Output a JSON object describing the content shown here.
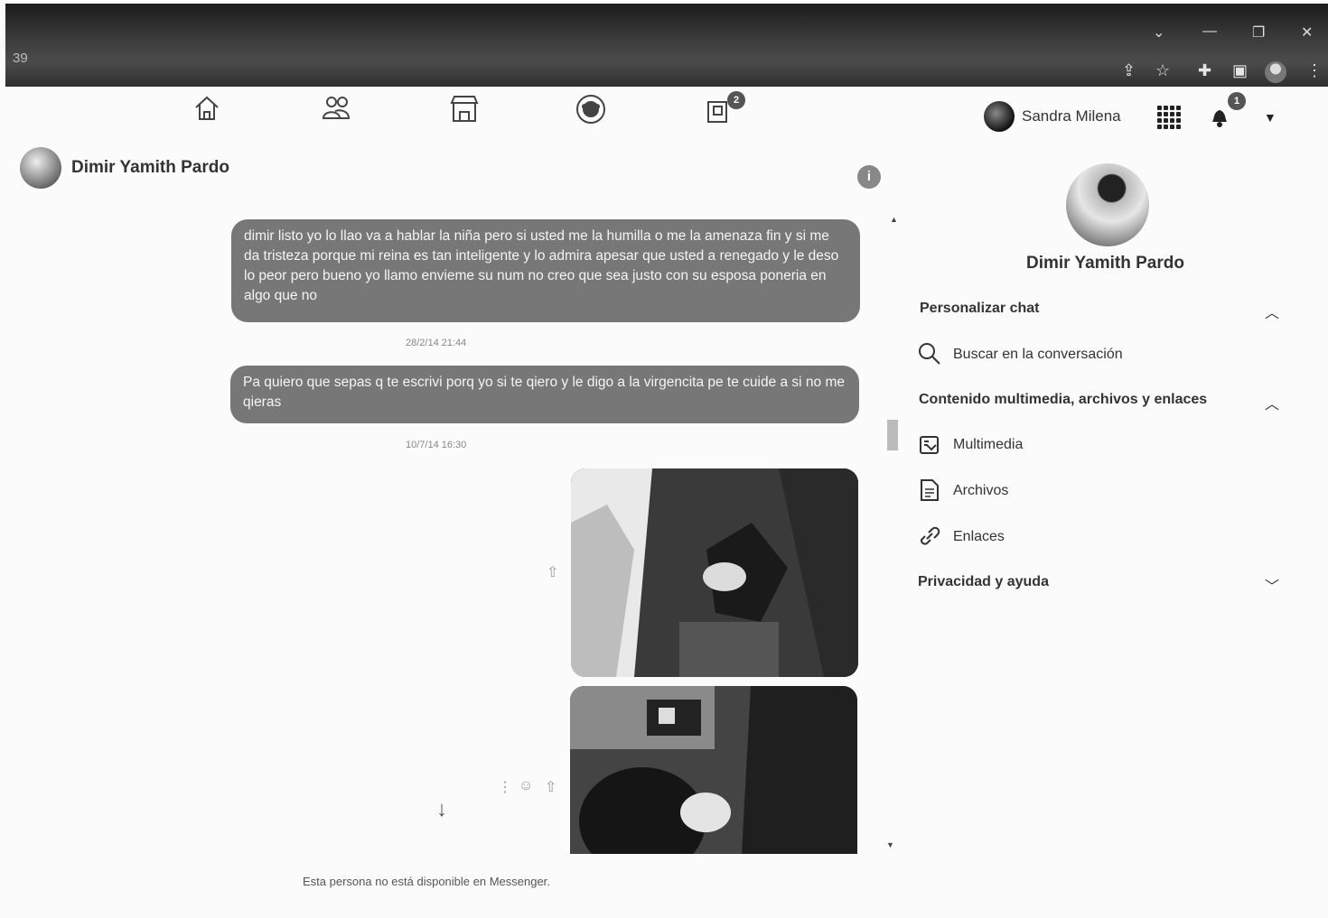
{
  "browser": {
    "tab_number": "39",
    "window_controls": [
      "⌄",
      "—",
      "❐",
      "✕"
    ],
    "toolbar_icons": [
      "share-icon",
      "star-icon",
      "extension-icon",
      "sidepanel-icon",
      "profile-icon",
      "menu-icon"
    ]
  },
  "topnav": {
    "icons": [
      "home-icon",
      "friends-icon",
      "marketplace-icon",
      "groups-icon",
      "gaming-icon"
    ],
    "gaming_badge": "2",
    "user_name": "Sandra Milena",
    "notifications_badge": "1"
  },
  "chat": {
    "contact_name": "Dimir Yamith Pardo",
    "messages": [
      {
        "text": "dimir listo yo lo llao va a hablar la niña pero si usted me la humilla o me la amenaza fin y si me da tristeza porque mi reina es tan inteligente y lo admira apesar que usted a renegado y le deso lo peor pero bueno yo llamo envieme su num no creo que sea justo con su esposa poneria en algo que no"
      },
      {
        "timestamp": "28/2/14 21:44",
        "text": "Pa quiero que sepas q te escrivi porq yo si te qiero y le digo a la virgencita pe te cuide a si no me qieras"
      },
      {
        "timestamp": "10/7/14 16:30"
      }
    ],
    "unavailable_notice": "Esta persona no está disponible en Messenger."
  },
  "panel": {
    "contact_name": "Dimir Yamith Pardo",
    "sections": {
      "customize": "Personalizar chat",
      "search": "Buscar en la conversación",
      "media_header": "Contenido multimedia, archivos y enlaces",
      "media": "Multimedia",
      "files": "Archivos",
      "links": "Enlaces",
      "privacy": "Privacidad y ayuda"
    }
  }
}
